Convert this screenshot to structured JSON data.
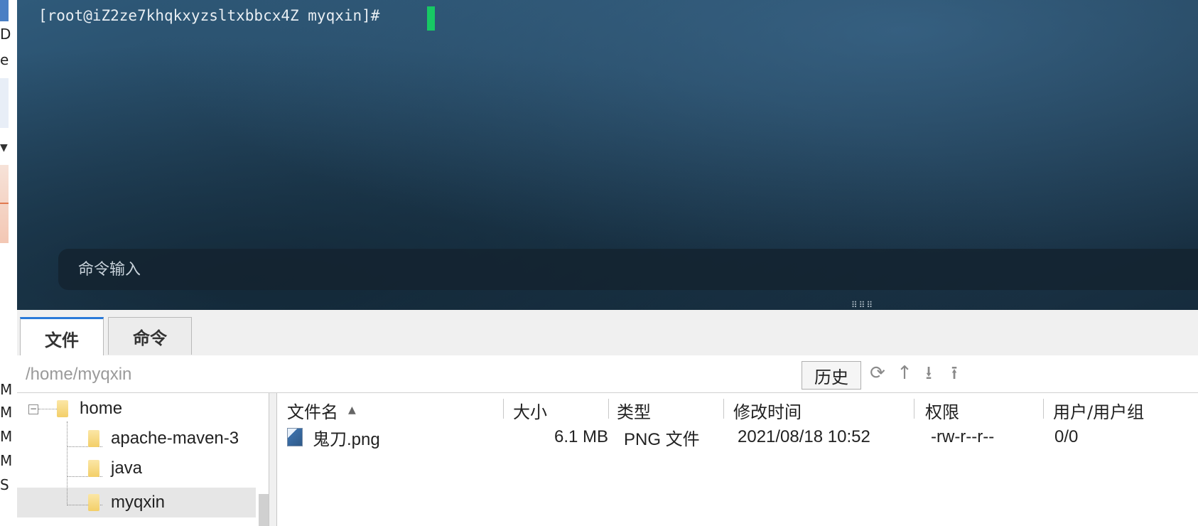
{
  "terminal": {
    "prompt": "[root@iZ2ze7khqkxyzsltxbbcx4Z myqxin]#",
    "command_placeholder": "命令输入"
  },
  "left_strip": {
    "fragments": [
      "D",
      "e",
      "M",
      "M",
      "M",
      "M",
      "S"
    ]
  },
  "tabs": [
    {
      "label": "文件",
      "active": true
    },
    {
      "label": "命令",
      "active": false
    }
  ],
  "pathbar": {
    "path": "/home/myqxin",
    "history_label": "历史",
    "icons": [
      "refresh-icon",
      "up-directory-icon",
      "download-icon",
      "upload-icon"
    ]
  },
  "tree": {
    "root": "home",
    "children": [
      "apache-maven-3",
      "java",
      "myqxin"
    ],
    "selected": "myqxin"
  },
  "file_table": {
    "columns": [
      "文件名",
      "大小",
      "类型",
      "修改时间",
      "权限",
      "用户/用户组"
    ],
    "sorted_column": "文件名",
    "rows": [
      {
        "name": "鬼刀.png",
        "size": "6.1 MB",
        "type": "PNG 文件",
        "modified": "2021/08/18 10:52",
        "permissions": "-rw-r--r--",
        "owner": "0/0"
      }
    ]
  },
  "colors": {
    "cursor": "#17c964",
    "active_tab_accent": "#2a7ad9"
  }
}
